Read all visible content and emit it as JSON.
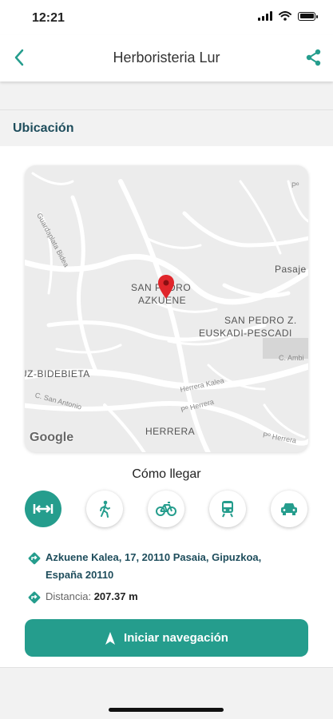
{
  "status_bar": {
    "time": "12:21"
  },
  "header": {
    "title": "Herboristeria Lur",
    "back_icon": "chevron-left-icon",
    "share_icon": "share-icon"
  },
  "section": {
    "title": "Ubicación"
  },
  "map": {
    "labels": {
      "san_pedro_1": "SAN PEDRO",
      "san_pedro_2": "AZKUENE",
      "san_pedro_z": "SAN PEDRO Z.",
      "euskadi": "EUSKADI-PESCADI",
      "bidebieta": "UZ-BIDEBIETA",
      "herrera": "HERRERA",
      "pasaje": "Pasaje",
      "guardaplata": "Guardaplata Bidea",
      "herrera_kalea": "Herrera Kalea",
      "c_san_antonio": "C. San Antonio",
      "p_herrera": "Pº Herrera",
      "p_herrera_2": "Pº Herrera",
      "c_ambi": "C. Ambi",
      "p_top": "Pº"
    },
    "attribution": "Google"
  },
  "directions": {
    "title": "Cómo llegar",
    "modes": [
      {
        "name": "route",
        "icon": "route-icon",
        "active": true
      },
      {
        "name": "walk",
        "icon": "walk-icon",
        "active": false
      },
      {
        "name": "bike",
        "icon": "bike-icon",
        "active": false
      },
      {
        "name": "transit",
        "icon": "train-icon",
        "active": false
      },
      {
        "name": "car",
        "icon": "car-icon",
        "active": false
      }
    ]
  },
  "info": {
    "address": "Azkuene Kalea, 17, 20110 Pasaia, Gipuzkoa, España 20110",
    "distance_label": "Distancia:",
    "distance_value": "207.37 m"
  },
  "cta": {
    "label": "Iniciar navegación"
  },
  "colors": {
    "accent": "#259d8d",
    "dark_teal": "#1e4d5c",
    "pin": "#e0262b"
  }
}
